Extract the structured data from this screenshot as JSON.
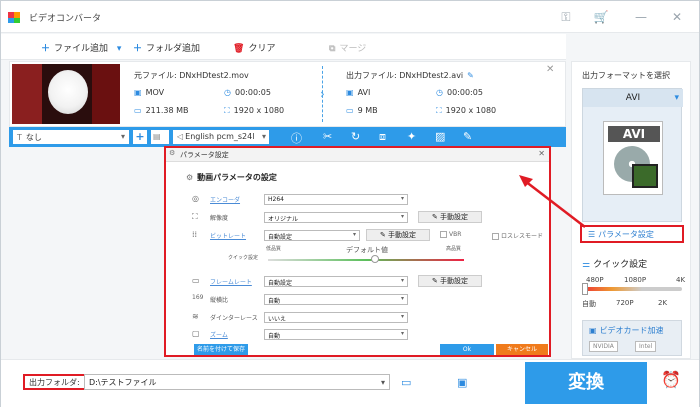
{
  "app": {
    "title": "ビデオコンバータ"
  },
  "toolbar": {
    "add_file": "ファイル追加",
    "add_folder": "フォルダ追加",
    "clear": "クリア",
    "merge": "マージ"
  },
  "file": {
    "source_label": "元ファイル: DNxHDtest2.mov",
    "source_format": "MOV",
    "source_duration": "00:00:05",
    "source_size": "211.38 MB",
    "source_resolution": "1920 x 1080",
    "output_label": "出力ファイル: DNxHDtest2.avi",
    "output_format": "AVI",
    "output_duration": "00:00:05",
    "output_size": "9 MB",
    "output_resolution": "1920 x 1080"
  },
  "bluebar": {
    "subtitle": "なし",
    "audio": "English pcm_s24l"
  },
  "right_panel": {
    "title": "出力フォーマットを選択",
    "format": "AVI",
    "format_icon_label": "AVI",
    "param_button": "パラメータ設定",
    "quick_title": "クイック設定",
    "quick_top": [
      "480P",
      "1080P",
      "4K"
    ],
    "quick_bottom": [
      "自動",
      "720P",
      "2K"
    ],
    "gpu_title": "ビデオカード加速",
    "gpu_chips": [
      "NVIDIA",
      "Intel"
    ]
  },
  "dialog": {
    "title": "パラメータ設定",
    "section": "動画パラメータの設定",
    "rows": [
      {
        "label": "エンコーダ",
        "value": "H264",
        "link": true
      },
      {
        "label": "解像度",
        "value": "オリジナル",
        "link": false
      },
      {
        "label": "ビットレート",
        "value": "自動設定",
        "link": true
      },
      {
        "label": "フレームレート",
        "value": "自動設定",
        "link": true
      },
      {
        "label": "縦横比",
        "value": "自動",
        "link": false
      },
      {
        "label": "ダインターレース",
        "value": "いいえ",
        "link": false
      },
      {
        "label": "ズーム",
        "value": "自動",
        "link": true
      }
    ],
    "manual_button": "手動設定",
    "vbr": "VBR",
    "lossless": "ロスレスモード",
    "quick_label": "クイック設定",
    "low_quality": "低品質",
    "default_value": "デフォルト値",
    "high_quality": "高品質",
    "save_as": "名前を付けて保存",
    "ok": "Ok",
    "cancel": "キャンセル"
  },
  "bottom": {
    "output_folder_label": "出力フォルダ:",
    "output_path": "D:\\テストファイル",
    "convert": "変換"
  }
}
